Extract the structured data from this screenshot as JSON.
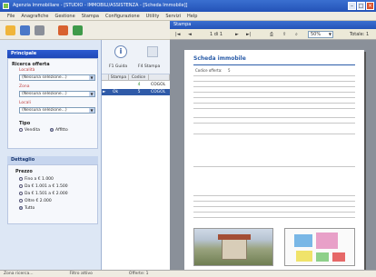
{
  "window": {
    "title": "Agenzia Immobiliare - [STUDIO - IMMOBILI/ASSISTENZA - [Scheda  Immobile]]"
  },
  "menu": [
    "File",
    "Anagrafiche",
    "Gestione",
    "Stampa",
    "Configurazione",
    "Utility",
    "Servizi",
    "Help"
  ],
  "left": {
    "principale": "Principale",
    "ricerca": "Ricerca offerta",
    "localita": "Località",
    "zona": "Zona",
    "locali": "Locali",
    "none": "(Nessuna selezione...)",
    "tipo": "Tipo",
    "vendita": "Vendita",
    "affitto": "Affitto",
    "dettaglio": "Dettaglio",
    "prezzo": "Prezzo",
    "prices": [
      "Fino a € 1.000",
      "Da € 1.001 a € 1.500",
      "Da € 1.501 a € 2.000",
      "Oltre € 2.000",
      "Tutto"
    ]
  },
  "mid": {
    "guida": "F1 Guida",
    "stampa": "F4 Stampa",
    "col_stampa": "Stampa",
    "col_codice": "Codice",
    "row1": {
      "check": "",
      "codice": "4",
      "name": "COGOL"
    },
    "row2": {
      "check": "Ok",
      "codice": "5",
      "name": "COGOL"
    }
  },
  "viewer": {
    "title": "Stampa",
    "page": "1 di 1",
    "zoom": "50%",
    "total": "Totale: 1",
    "doc_title": "Scheda immobile",
    "codice_label": "Codice offerta:",
    "codice_value": "5"
  },
  "status": {
    "left": "Zona ricerca...",
    "mid": "Filtro attivo",
    "right": "Offerte: 1"
  }
}
